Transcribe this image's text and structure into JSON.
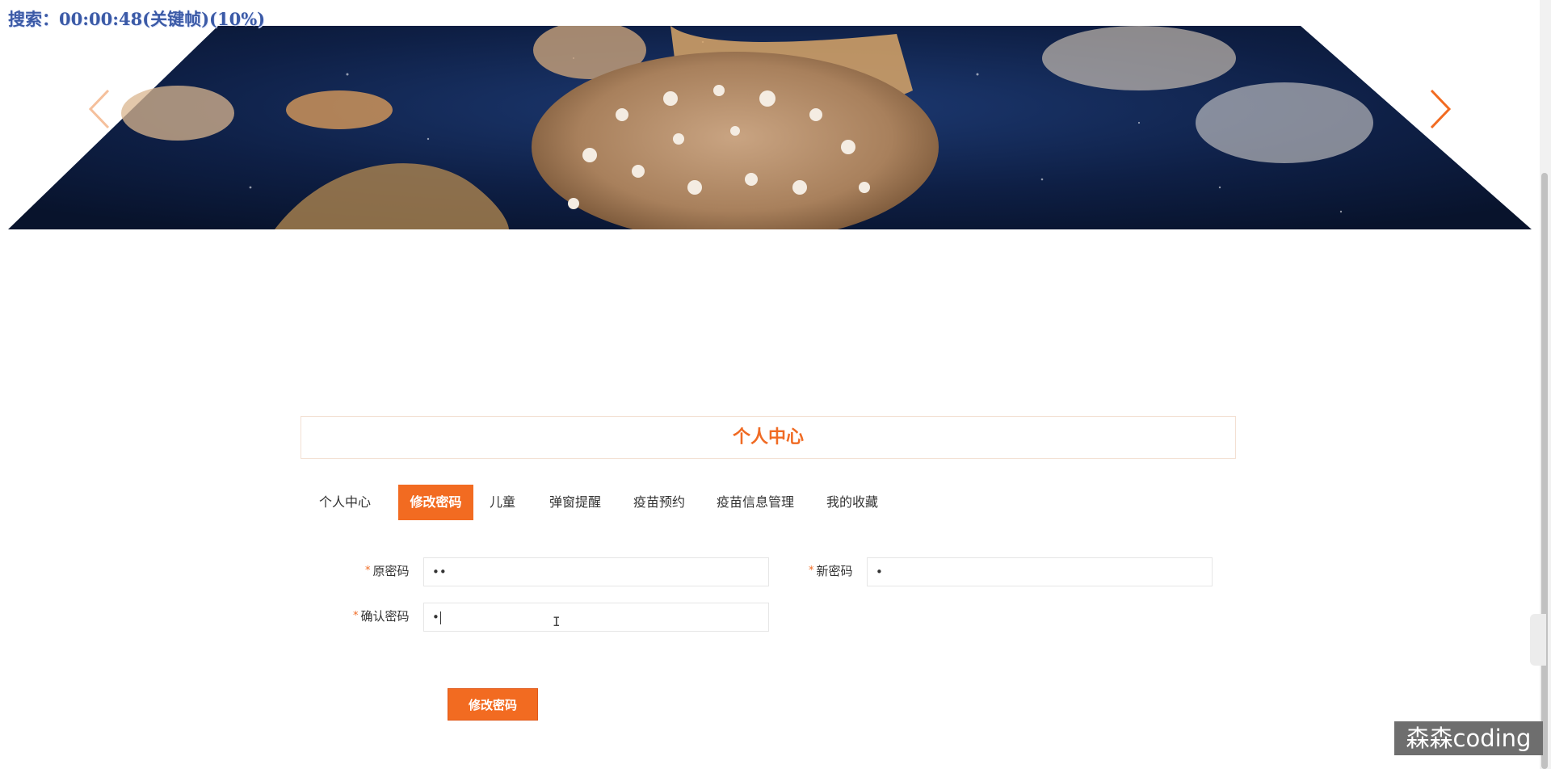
{
  "overlay": {
    "title": "搜索：00:00:48(关键帧)(10%)"
  },
  "banner": {
    "image": "jellyfish-banner",
    "prev_icon": "chevron-left-icon",
    "next_icon": "chevron-right-icon"
  },
  "panel": {
    "title": "个人中心"
  },
  "tabs": [
    {
      "label": "个人中心",
      "active": false
    },
    {
      "label": "修改密码",
      "active": true
    },
    {
      "label": "儿童",
      "active": false
    },
    {
      "label": "弹窗提醒",
      "active": false
    },
    {
      "label": "疫苗预约",
      "active": false
    },
    {
      "label": "疫苗信息管理",
      "active": false
    },
    {
      "label": "我的收藏",
      "active": false
    }
  ],
  "form": {
    "required_mark": "*",
    "old_password": {
      "label": "原密码",
      "value": "••"
    },
    "new_password": {
      "label": "新密码",
      "value": "•"
    },
    "confirm_password": {
      "label": "确认密码",
      "value": "•"
    },
    "submit_label": "修改密码"
  },
  "watermark": {
    "text": "森森coding"
  },
  "colors": {
    "accent": "#f26b21",
    "overlay_text": "#3b5aa6"
  }
}
